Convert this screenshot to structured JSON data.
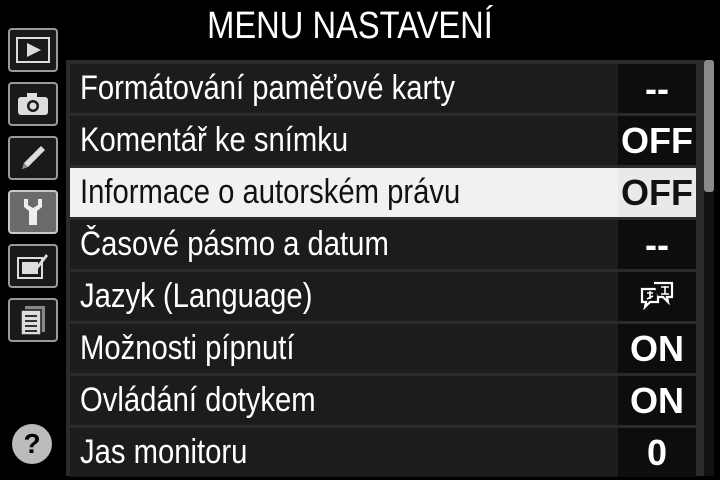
{
  "header": {
    "title": "MENU NASTAVENÍ"
  },
  "tabs": [
    {
      "icon": "playback-icon",
      "active": false
    },
    {
      "icon": "camera-icon",
      "active": false
    },
    {
      "icon": "pencil-icon",
      "active": false
    },
    {
      "icon": "wrench-icon",
      "active": true
    },
    {
      "icon": "retouch-icon",
      "active": false
    },
    {
      "icon": "my-menu-icon",
      "active": false
    }
  ],
  "help": {
    "label": "?"
  },
  "menu": {
    "items": [
      {
        "label": "Formátování paměťové karty",
        "value": "--"
      },
      {
        "label": "Komentář ke snímku",
        "value": "OFF"
      },
      {
        "label": "Informace o autorském právu",
        "value": "OFF",
        "selected": true
      },
      {
        "label": "Časové pásmo a datum",
        "value": "--"
      },
      {
        "label": "Jazyk (Language)",
        "value": "",
        "value_icon": "language-icon"
      },
      {
        "label": "Možnosti pípnutí",
        "value": "ON"
      },
      {
        "label": "Ovládání dotykem",
        "value": "ON"
      },
      {
        "label": "Jas monitoru",
        "value": "0"
      }
    ]
  }
}
